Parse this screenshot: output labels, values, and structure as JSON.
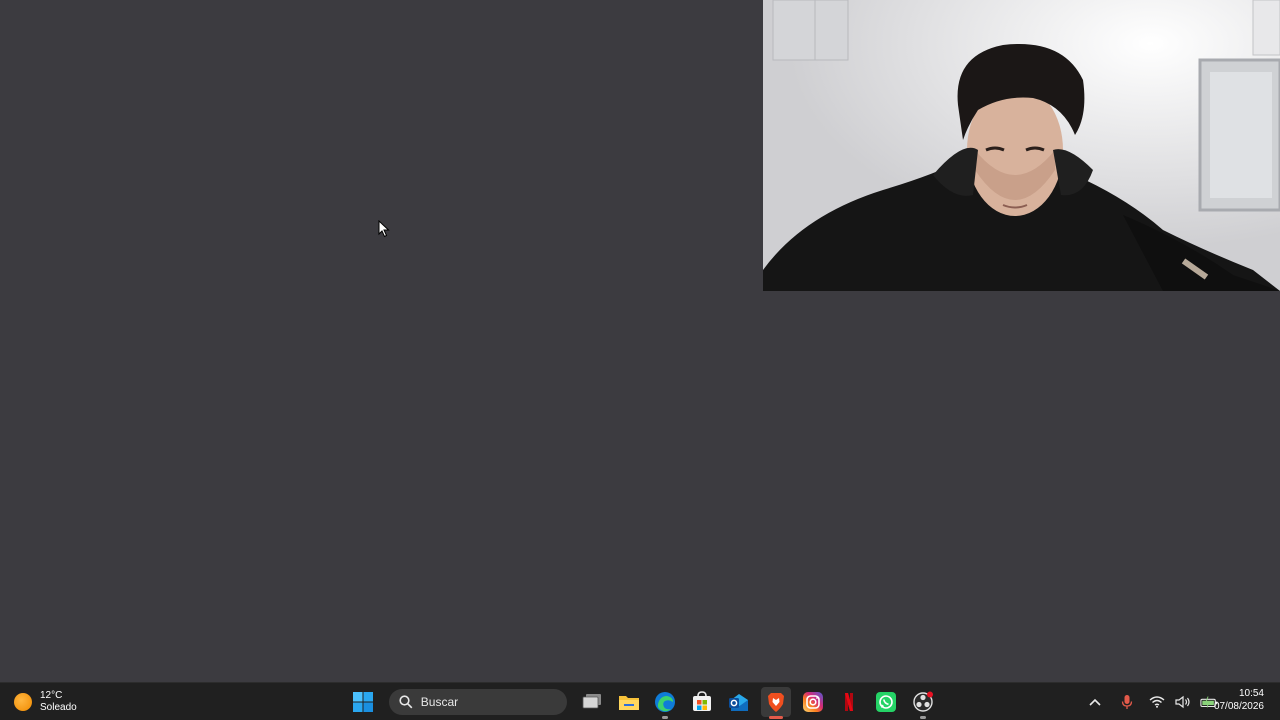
{
  "weather": {
    "temperature": "12°C",
    "condition": "Soleado",
    "icon": "sun-icon"
  },
  "taskbar": {
    "search_label": "Buscar",
    "apps": [
      {
        "name": "start",
        "icon": "windows-logo-icon"
      },
      {
        "name": "task-view",
        "icon": "task-view-icon"
      },
      {
        "name": "file-explorer",
        "icon": "folder-icon"
      },
      {
        "name": "edge",
        "icon": "edge-icon"
      },
      {
        "name": "store",
        "icon": "store-icon"
      },
      {
        "name": "outlook",
        "icon": "outlook-icon"
      },
      {
        "name": "brave",
        "icon": "brave-lion-icon",
        "active": true
      },
      {
        "name": "instagram",
        "icon": "instagram-icon"
      },
      {
        "name": "netflix",
        "icon": "netflix-icon"
      },
      {
        "name": "whatsapp",
        "icon": "whatsapp-icon"
      },
      {
        "name": "obs",
        "icon": "obs-icon"
      }
    ]
  },
  "tray": {
    "icons": [
      "chevron-up-icon",
      "microphone-icon",
      "wifi-icon",
      "speaker-icon",
      "battery-icon"
    ]
  },
  "clock": {
    "time": "10:54",
    "date": "07/08/2026"
  },
  "colors": {
    "desktop": "#3c3b40",
    "taskbar": "#202020",
    "accent_active": "#e35a4a",
    "whatsapp": "#25d366",
    "outlook": "#0f6cbd",
    "netflix": "#e50914"
  }
}
